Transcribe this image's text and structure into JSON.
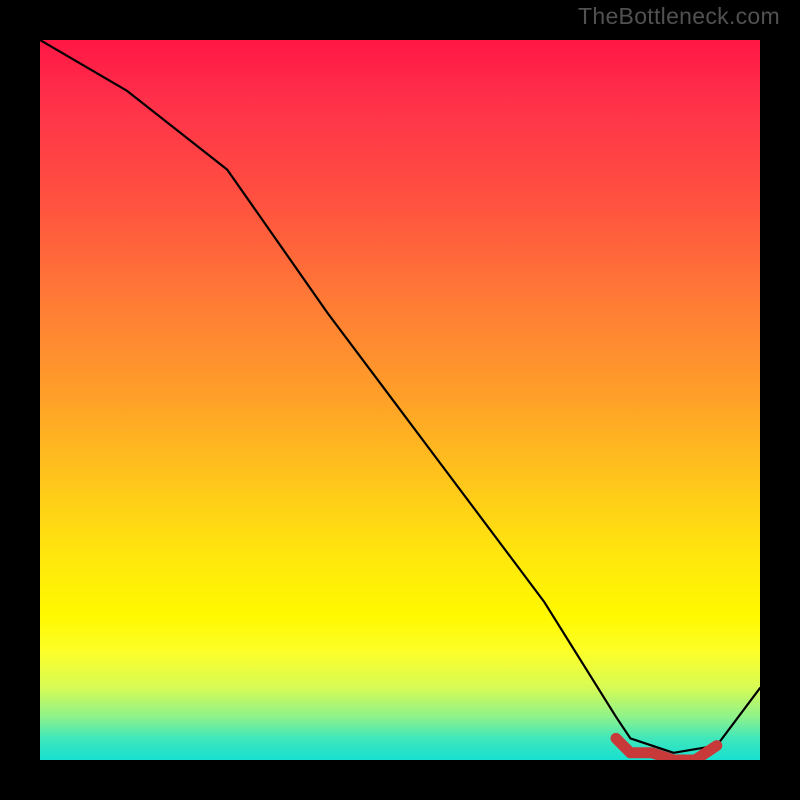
{
  "watermark": "TheBottleneck.com",
  "chart_data": {
    "type": "line",
    "title": "",
    "xlabel": "",
    "ylabel": "",
    "xlim": [
      0,
      100
    ],
    "ylim": [
      0,
      100
    ],
    "grid": false,
    "legend": false,
    "series": [
      {
        "name": "black-curve",
        "color": "#000000",
        "x": [
          0,
          12,
          26,
          40,
          55,
          70,
          80,
          82,
          88,
          94,
          100
        ],
        "y": [
          100,
          93,
          82,
          62,
          42,
          22,
          6,
          3,
          1,
          2,
          10
        ]
      },
      {
        "name": "red-bottom-band",
        "color": "#c83a3a",
        "x": [
          80,
          82,
          85,
          88,
          91,
          94
        ],
        "y": [
          3,
          1,
          1,
          0,
          0,
          2
        ]
      }
    ],
    "notes": "Axes have no visible tick labels; values are reverse-engineered on a 0–100 normalized scale from the rendered geometry. The red series is a short, thick segment near the bottom-right where the black curve reaches its minimum."
  }
}
